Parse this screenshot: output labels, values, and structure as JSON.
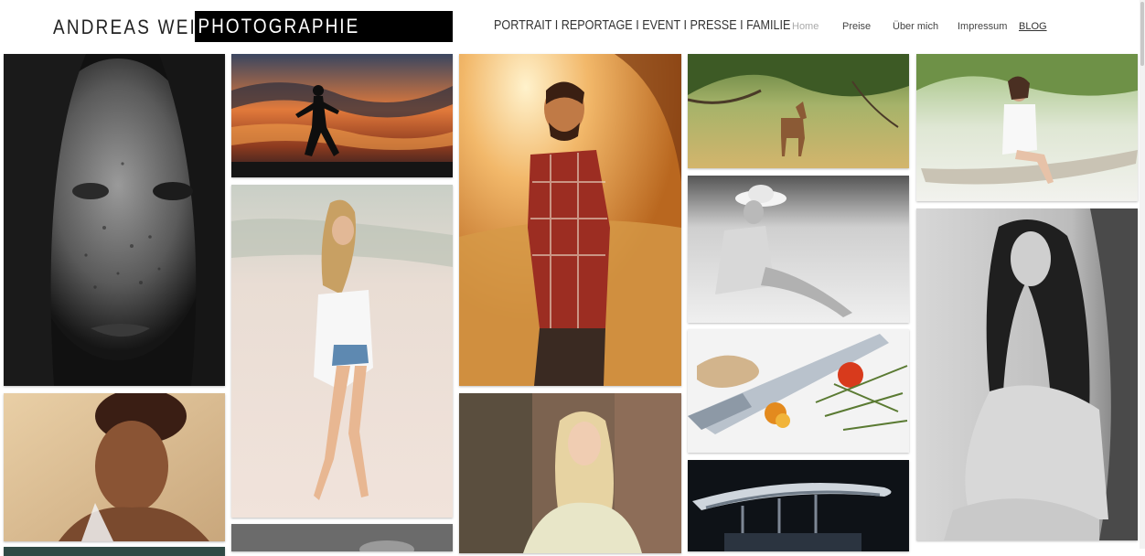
{
  "header": {
    "brand_name": "ANDREAS WEISE",
    "brand_highlight": "PHOTOGRAPHIE",
    "tagline": "PORTRAIT I REPORTAGE I EVENT I PRESSE I FAMILIE"
  },
  "nav": {
    "items": [
      {
        "label": "Home",
        "active": true
      },
      {
        "label": "Preise",
        "active": false
      },
      {
        "label": "Über mich",
        "active": false
      },
      {
        "label": "Impressum",
        "active": false
      },
      {
        "label": "BLOG",
        "active": false
      }
    ]
  },
  "colors": {
    "background": "#ffffff",
    "brand_box": "#000000",
    "nav_active": "#aaaaaa",
    "nav_text": "#444444"
  },
  "gallery": {
    "tiles": [
      {
        "name": "freckled-woman-portrait-photo",
        "theme": "bw-portrait"
      },
      {
        "name": "woman-face-warm-portrait-photo",
        "theme": "warm-portrait"
      },
      {
        "name": "runner-silhouette-sunset-photo",
        "theme": "sunset-sky"
      },
      {
        "name": "woman-walking-beach-photo",
        "theme": "beach"
      },
      {
        "name": "bw-bottom-photo",
        "theme": "bw-strip"
      },
      {
        "name": "man-plaid-shirt-golden-hour-photo",
        "theme": "golden-field"
      },
      {
        "name": "blonde-woman-outdoor-photo",
        "theme": "muted-portrait"
      },
      {
        "name": "deer-in-meadow-photo",
        "theme": "meadow"
      },
      {
        "name": "woman-hat-sand-bw-photo",
        "theme": "bw-sand"
      },
      {
        "name": "knife-tomato-herbs-photo",
        "theme": "food"
      },
      {
        "name": "modern-architecture-night-photo",
        "theme": "night-architecture"
      },
      {
        "name": "woman-on-branch-photo",
        "theme": "bright-park"
      },
      {
        "name": "woman-long-hair-bw-photo",
        "theme": "bw-portrait-2"
      }
    ]
  }
}
